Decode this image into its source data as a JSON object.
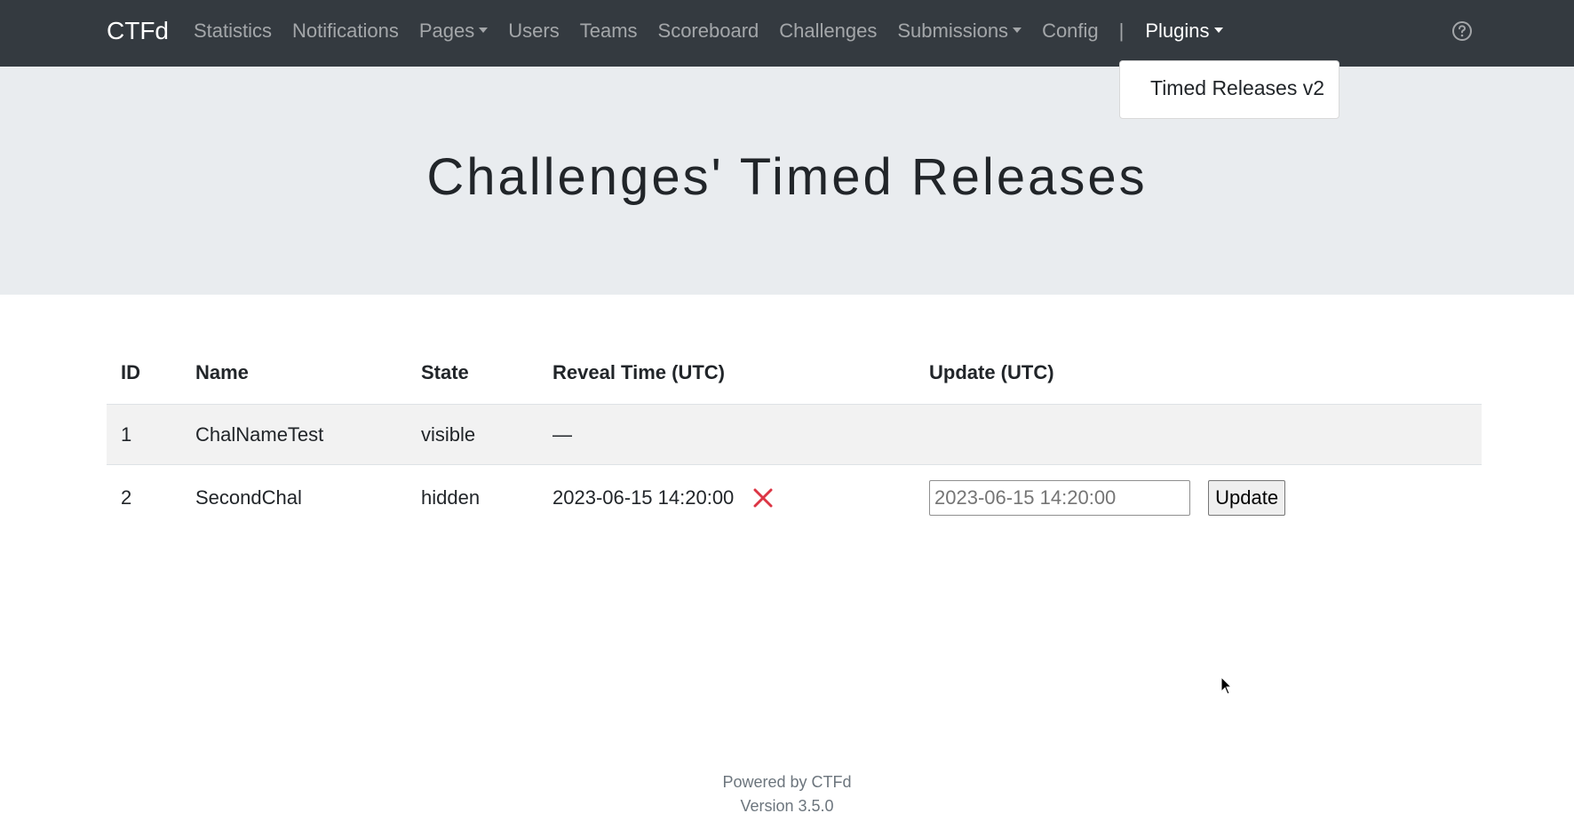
{
  "navbar": {
    "brand": "CTFd",
    "items": [
      {
        "label": "Statistics",
        "dropdown": false
      },
      {
        "label": "Notifications",
        "dropdown": false
      },
      {
        "label": "Pages",
        "dropdown": true
      },
      {
        "label": "Users",
        "dropdown": false
      },
      {
        "label": "Teams",
        "dropdown": false
      },
      {
        "label": "Scoreboard",
        "dropdown": false
      },
      {
        "label": "Challenges",
        "dropdown": false
      },
      {
        "label": "Submissions",
        "dropdown": true
      },
      {
        "label": "Config",
        "dropdown": false
      }
    ],
    "separator": "|",
    "plugins_label": "Plugins",
    "help_icon": "question-circle-icon"
  },
  "plugins_dropdown": {
    "items": [
      "Timed Releases v2"
    ]
  },
  "page": {
    "title": "Challenges' Timed Releases"
  },
  "table": {
    "headers": [
      "ID",
      "Name",
      "State",
      "Reveal Time (UTC)",
      "Update (UTC)"
    ],
    "rows": [
      {
        "id": "1",
        "name": "ChalNameTest",
        "state": "visible",
        "reveal_time": "—"
      },
      {
        "id": "2",
        "name": "SecondChal",
        "state": "hidden",
        "reveal_time": "2023-06-15 14:20:00",
        "update_placeholder": "2023-06-15 14:20:00",
        "update_button": "Update"
      }
    ]
  },
  "footer": {
    "powered_by": "Powered by CTFd",
    "version": "Version 3.5.0"
  },
  "colors": {
    "navbar_bg": "#343a40",
    "jumbotron_bg": "#e9ecef",
    "delete_red": "#dc3545"
  }
}
